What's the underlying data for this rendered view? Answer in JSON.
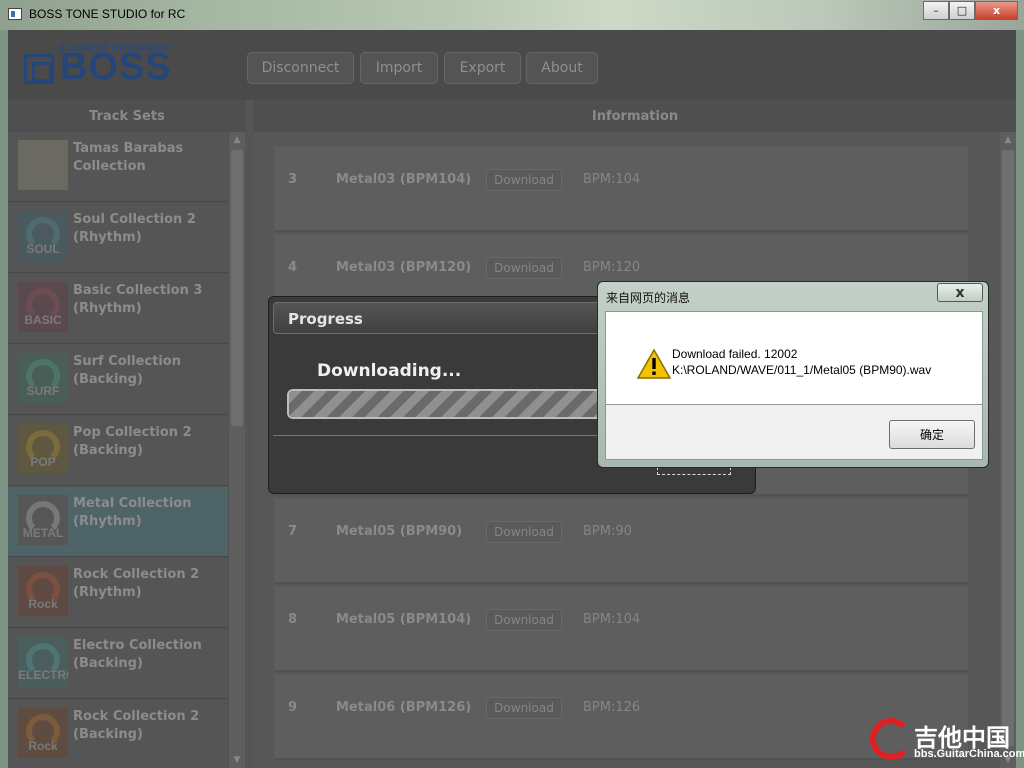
{
  "window": {
    "title": "BOSS TONE STUDIO for RC",
    "minimize": "–",
    "maximize": "□",
    "close": "x"
  },
  "header": {
    "logo_sub": "a sound innovator",
    "logo_text": "BOSS",
    "buttons": [
      "Disconnect",
      "Import",
      "Export",
      "About"
    ]
  },
  "columns": {
    "track_sets": "Track Sets",
    "information": "Information"
  },
  "track_sets": [
    {
      "line1": "Tamas Barabas",
      "line2": "Collection",
      "thumb": ""
    },
    {
      "line1": "Soul Collection 2",
      "line2": "(Rhythm)",
      "thumb": "SOUL"
    },
    {
      "line1": "Basic Collection 3",
      "line2": "(Rhythm)",
      "thumb": "BASIC"
    },
    {
      "line1": "Surf Collection",
      "line2": "(Backing)",
      "thumb": "SURF"
    },
    {
      "line1": "Pop Collection 2",
      "line2": "(Backing)",
      "thumb": "POP"
    },
    {
      "line1": "Metal Collection",
      "line2": "(Rhythm)",
      "thumb": "METAL"
    },
    {
      "line1": "Rock Collection 2",
      "line2": "(Rhythm)",
      "thumb": "Rock"
    },
    {
      "line1": "Electro Collection",
      "line2": "(Backing)",
      "thumb": "ELECTRO"
    },
    {
      "line1": "Rock Collection 2",
      "line2": "(Backing)",
      "thumb": "Rock"
    }
  ],
  "selected_track_set": 5,
  "tracks": [
    {
      "num": "3",
      "name": "Metal03 (BPM104)",
      "button": "Download",
      "bpm": "BPM:104"
    },
    {
      "num": "4",
      "name": "Metal03 (BPM120)",
      "button": "Download",
      "bpm": "BPM:120"
    },
    {
      "num": "7",
      "name": "Metal05 (BPM90)",
      "button": "Download",
      "bpm": "BPM:90"
    },
    {
      "num": "8",
      "name": "Metal05 (BPM104)",
      "button": "Download",
      "bpm": "BPM:104"
    },
    {
      "num": "9",
      "name": "Metal06 (BPM126)",
      "button": "Download",
      "bpm": "BPM:126"
    }
  ],
  "progress_dialog": {
    "title": "Progress",
    "message": "Downloading...",
    "progress_percent": 75
  },
  "message_box": {
    "title": "来自网页的消息",
    "close": "x",
    "line1": "Download failed. 12002",
    "line2": "K:\\ROLAND/WAVE/011_1/Metal05 (BPM90).wav",
    "ok": "确定"
  },
  "watermark": {
    "brand": "吉他中国",
    "url": "bbs.GuitarChina.com"
  },
  "colors": {
    "boss_blue": "#26467a",
    "warning_yellow": "#f2c400"
  }
}
